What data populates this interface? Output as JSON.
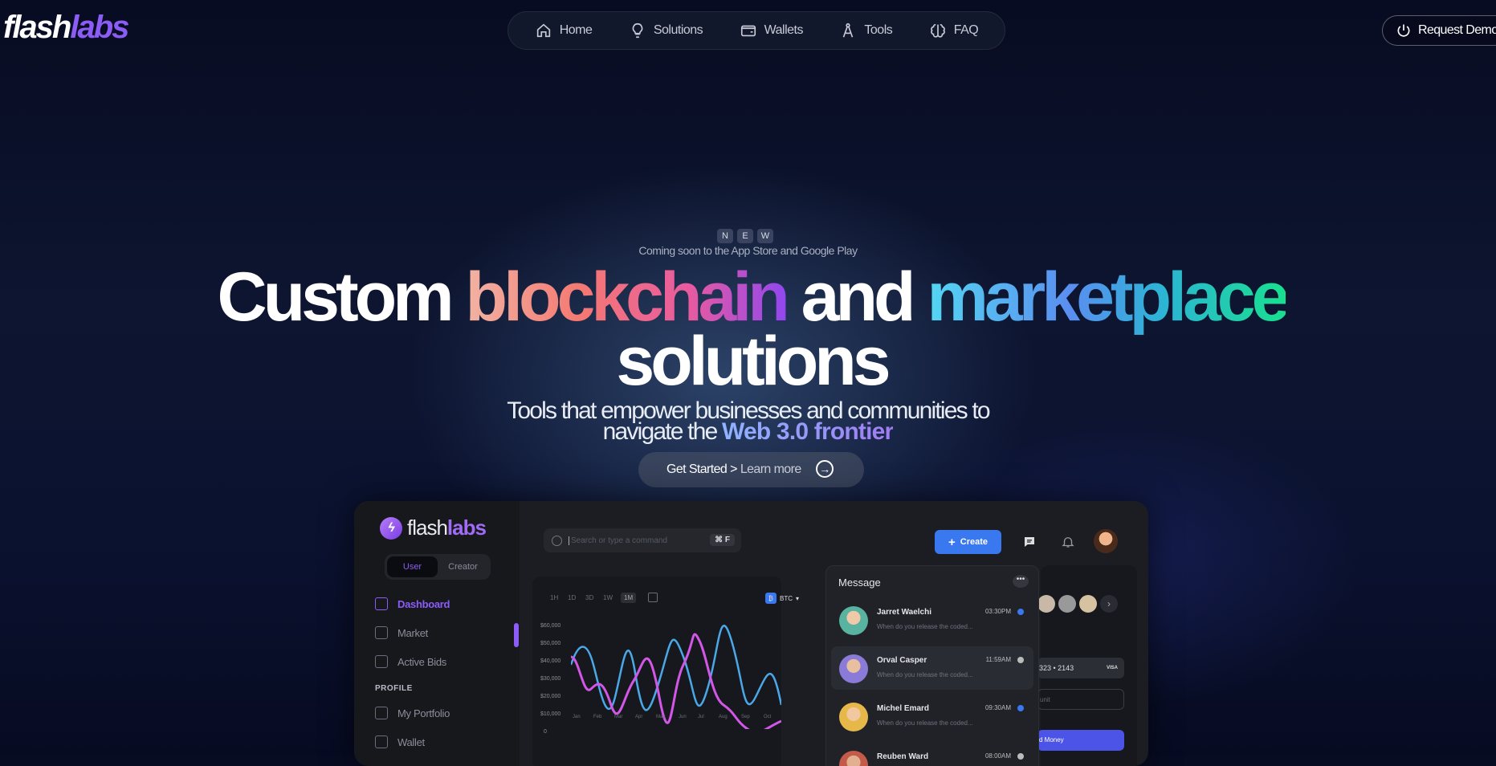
{
  "brand": {
    "logo_part1": "flash",
    "logo_part2": "labs"
  },
  "nav": {
    "items": [
      {
        "label": "Home",
        "icon": "home-icon"
      },
      {
        "label": "Solutions",
        "icon": "lightbulb-icon"
      },
      {
        "label": "Wallets",
        "icon": "wallet-icon"
      },
      {
        "label": "Tools",
        "icon": "compass-tool-icon"
      },
      {
        "label": "FAQ",
        "icon": "brain-icon"
      }
    ],
    "request_demo": "Request Demo"
  },
  "hero": {
    "new_letters": [
      "N",
      "E",
      "W"
    ],
    "coming_soon": "Coming soon to the App Store and Google Play",
    "title_1": "Custom ",
    "title_2": "blockchain",
    "title_3": " and ",
    "title_4": "marketplace",
    "title_5": "solutions",
    "subtitle_1": "Tools that empower businesses and communities to",
    "subtitle_2": "navigate the ",
    "subtitle_highlight": "Web 3.0 frontier",
    "cta_primary": "Get Started >",
    "cta_secondary": "Learn more"
  },
  "dashboard": {
    "logo_1": "flash",
    "logo_2": "labs",
    "toggle": [
      "User",
      "Creator"
    ],
    "menu": [
      "Dashboard",
      "Market",
      "Active Bids"
    ],
    "profile_heading": "PROFILE",
    "profile_menu": [
      "My Portfolio",
      "Wallet"
    ],
    "search_placeholder": "Search or type a command",
    "search_shortcut": "⌘ F",
    "create_label": "Create",
    "timeframes": [
      "1H",
      "1D",
      "3D",
      "1W",
      "1M"
    ],
    "coin": "BTC",
    "y_ticks": [
      "$60,000",
      "$50,000",
      "$40,000",
      "$30,000",
      "$20,000",
      "$10,000",
      "0"
    ],
    "x_ticks": [
      "Jan",
      "Feb",
      "Mar",
      "Apr",
      "May",
      "Jun",
      "Jul",
      "Aug",
      "Sep",
      "Oct"
    ],
    "card_text": "323 • 2143",
    "card_badge": "VISA",
    "amount_placeholder": "unit",
    "send_button": "d Money",
    "messages": {
      "title": "Message",
      "items": [
        {
          "name": "Jarret Waelchi",
          "time": "03:30PM",
          "text": "When do you release the coded...",
          "status": "#3978ef"
        },
        {
          "name": "Orval Casper",
          "time": "11:59AM",
          "text": "When do you release the coded...",
          "status": "#bbbbbb"
        },
        {
          "name": "Michel Emard",
          "time": "09:30AM",
          "text": "When do you release the coded...",
          "status": "#3978ef"
        },
        {
          "name": "Reuben Ward",
          "time": "08:00AM",
          "text": "",
          "status": "#bbbbbb"
        }
      ]
    }
  },
  "colors": {
    "accent_purple": "#8b5cf6",
    "accent_blue": "#3978ef",
    "bg": "#0b1230"
  }
}
